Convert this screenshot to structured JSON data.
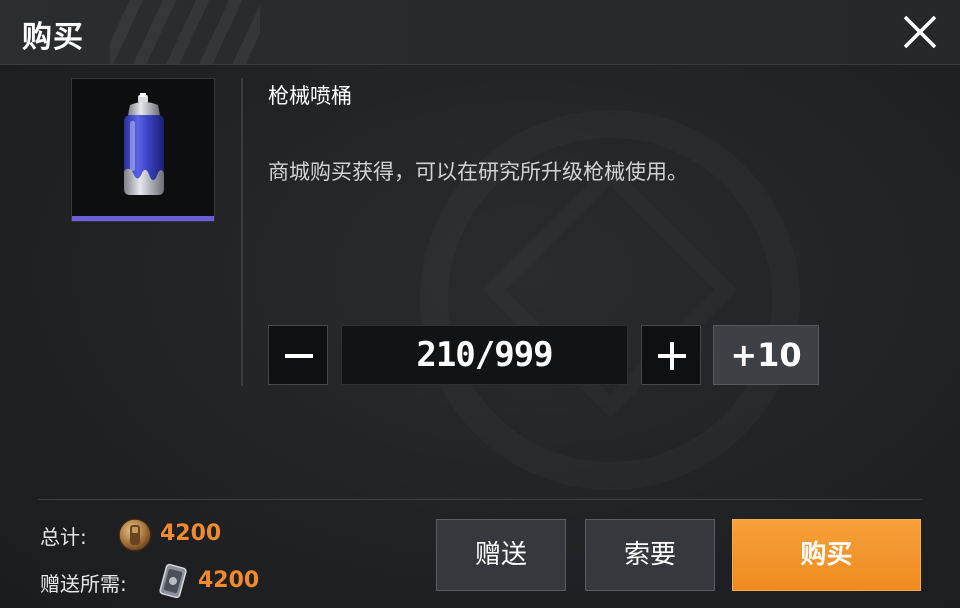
{
  "header": {
    "title": "购买"
  },
  "item": {
    "name": "枪械喷桶",
    "description": "商城购买获得，可以在研究所升级枪械使用。",
    "icon": "spray-can-icon",
    "rarity_color": "#6a5fd8"
  },
  "quantity": {
    "value": "210/999",
    "plus10_label": "+10"
  },
  "totals": {
    "total_label": "总计:",
    "total_value": "4200",
    "gift_label": "赠送所需:",
    "gift_value": "4200"
  },
  "actions": {
    "gift_label": "赠送",
    "request_label": "索要",
    "buy_label": "购买"
  },
  "colors": {
    "accent": "#f08a2c",
    "buy_button": "#ef8a1e"
  }
}
